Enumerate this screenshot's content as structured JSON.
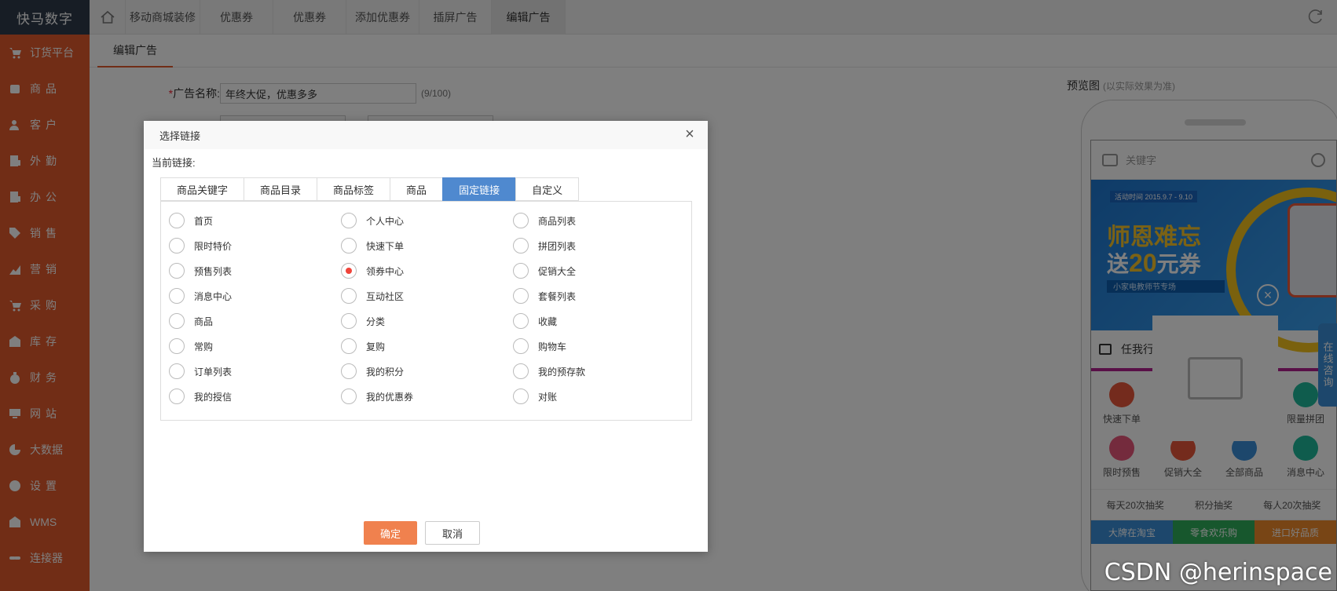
{
  "brand": "快马数字",
  "sidebar": {
    "items": [
      {
        "label": "订货平台",
        "icon": "cart-icon"
      },
      {
        "label": "商品",
        "icon": "box-icon"
      },
      {
        "label": "客户",
        "icon": "user-icon"
      },
      {
        "label": "外勤",
        "icon": "clipboard-icon"
      },
      {
        "label": "办公",
        "icon": "clipboard-icon"
      },
      {
        "label": "销售",
        "icon": "tag-icon"
      },
      {
        "label": "营销",
        "icon": "chart-icon"
      },
      {
        "label": "采购",
        "icon": "cart-icon"
      },
      {
        "label": "库存",
        "icon": "warehouse-icon"
      },
      {
        "label": "财务",
        "icon": "money-bag-icon"
      },
      {
        "label": "网站",
        "icon": "monitor-icon"
      },
      {
        "label": "大数据",
        "icon": "pie-chart-icon"
      },
      {
        "label": "设置",
        "icon": "gear-icon"
      },
      {
        "label": "WMS",
        "icon": "wms-icon"
      },
      {
        "label": "连接器",
        "icon": "link-icon"
      }
    ]
  },
  "topbar": {
    "tabs": [
      {
        "label": "移动商城装修"
      },
      {
        "label": "优惠券"
      },
      {
        "label": "优惠券"
      },
      {
        "label": "添加优惠券"
      },
      {
        "label": "插屏广告"
      },
      {
        "label": "编辑广告",
        "active": true
      }
    ]
  },
  "page": {
    "subtab": "编辑广告",
    "ad_name_label": "广告名称:",
    "ad_name_required": "*",
    "ad_name_value": "年终大促，优惠多多",
    "ad_name_count": "(9/100)",
    "preview_title": "预览图",
    "preview_note": "(以实际效果为准)"
  },
  "phone": {
    "search_placeholder": "关键字",
    "banner_tag": "活动时间 2015.9.7 - 9.10",
    "banner_line1": "师恩难忘",
    "banner_line2a": "送",
    "banner_line2b": "20",
    "banner_line2c": "元券",
    "banner_line3": "小家电教师节专场",
    "notice_text": "任我行",
    "icons": [
      {
        "label": "快速下单",
        "color": "#e8573a"
      },
      {
        "label": "",
        "color": "#ffffff"
      },
      {
        "label": "",
        "color": "#ffffff"
      },
      {
        "label": "限量拼团",
        "color": "#1fb89a"
      },
      {
        "label": "限时预售",
        "color": "#e8577a"
      },
      {
        "label": "促销大全",
        "color": "#e8573a"
      },
      {
        "label": "全部商品",
        "color": "#3a8fd8"
      },
      {
        "label": "消息中心",
        "color": "#1fb89a"
      }
    ],
    "lottery": [
      "每天20次抽奖",
      "积分抽奖",
      "每人20次抽奖"
    ],
    "cats": [
      {
        "label": "大牌在淘宝",
        "color": "#3a8fd8"
      },
      {
        "label": "零食欢乐购",
        "color": "#2fae5a"
      },
      {
        "label": "进口好品质",
        "color": "#f08a2a"
      }
    ],
    "cs_label": "在线咨询"
  },
  "modal": {
    "title": "选择链接",
    "current_link_label": "当前链接:",
    "tabs": [
      {
        "label": "商品关键字"
      },
      {
        "label": "商品目录"
      },
      {
        "label": "商品标签"
      },
      {
        "label": "商品"
      },
      {
        "label": "固定链接",
        "active": true
      },
      {
        "label": "自定义"
      }
    ],
    "options": [
      {
        "label": "首页"
      },
      {
        "label": "个人中心"
      },
      {
        "label": "商品列表"
      },
      {
        "label": "限时特价"
      },
      {
        "label": "快速下单"
      },
      {
        "label": "拼团列表"
      },
      {
        "label": "预售列表"
      },
      {
        "label": "领券中心",
        "selected": true
      },
      {
        "label": "促销大全"
      },
      {
        "label": "消息中心"
      },
      {
        "label": "互动社区"
      },
      {
        "label": "套餐列表"
      },
      {
        "label": "商品"
      },
      {
        "label": "分类"
      },
      {
        "label": "收藏"
      },
      {
        "label": "常购"
      },
      {
        "label": "复购"
      },
      {
        "label": "购物车"
      },
      {
        "label": "订单列表"
      },
      {
        "label": "我的积分"
      },
      {
        "label": "我的预存款"
      },
      {
        "label": "我的授信"
      },
      {
        "label": "我的优惠券"
      },
      {
        "label": "对账"
      }
    ],
    "ok_label": "确定",
    "cancel_label": "取消"
  },
  "watermark": "CSDN @herinspace"
}
